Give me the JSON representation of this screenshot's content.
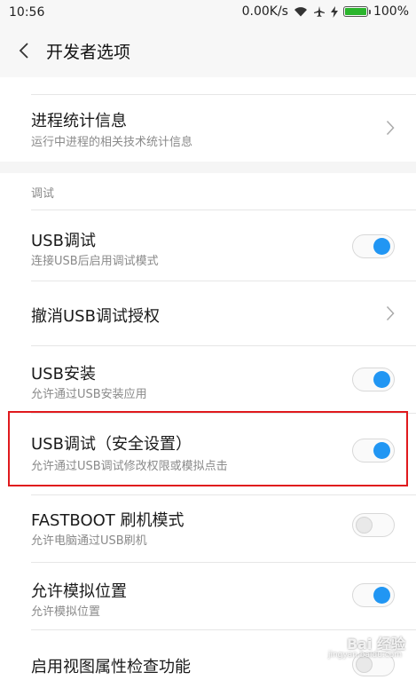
{
  "status_bar": {
    "time": "10:56",
    "network_speed": "0.00K/s",
    "battery_level": "100%",
    "battery_fraction": 1.0,
    "battery_color": "#2bb52d"
  },
  "header": {
    "back_icon": "chevron-left-icon",
    "title": "开发者选项"
  },
  "items": {
    "process_stats": {
      "title": "进程统计信息",
      "subtitle": "运行中进程的相关技术统计信息"
    },
    "section_debug": {
      "label": "调试"
    },
    "usb_debug": {
      "title": "USB调试",
      "subtitle": "连接USB后启用调试模式",
      "enabled": true
    },
    "revoke_usb_auth": {
      "title": "撤消USB调试授权"
    },
    "usb_install": {
      "title": "USB安装",
      "subtitle": "允许通过USB安装应用",
      "enabled": true
    },
    "usb_debug_security": {
      "title": "USB调试（安全设置）",
      "subtitle": "允许通过USB调试修改权限或模拟点击",
      "enabled": true
    },
    "fastboot": {
      "title": "FASTBOOT 刷机模式",
      "subtitle": "允许电脑通过USB刷机",
      "enabled": false
    },
    "mock_location": {
      "title": "允许模拟位置",
      "subtitle": "允许模拟位置",
      "enabled": true
    },
    "view_attribute": {
      "title": "启用视图属性检查功能",
      "enabled": false
    }
  },
  "watermark": {
    "text": "Bai 经验",
    "sub": "jingyan.baidu.com"
  },
  "colors": {
    "toggle_on": "#2196f3",
    "highlight": "#e0191d"
  }
}
